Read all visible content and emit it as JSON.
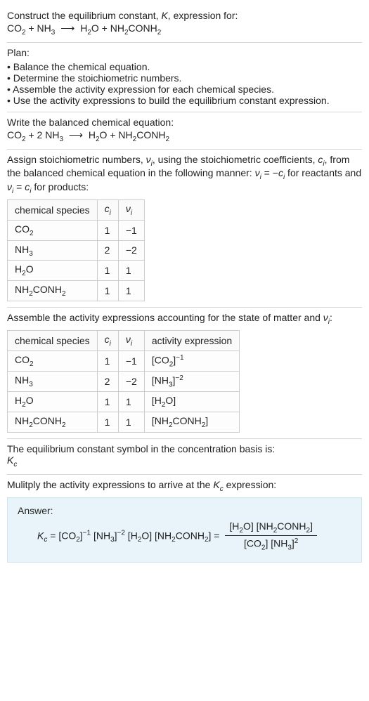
{
  "intro": {
    "line1": "Construct the equilibrium constant, ",
    "kital": "K",
    "line1b": ", expression for:"
  },
  "eq_unbalanced": {
    "co2": "CO",
    "co2_sub": "2",
    "plus1": " + ",
    "nh3": "NH",
    "nh3_sub": "3",
    "arrow": "⟶",
    "h2o": "H",
    "h2o_sub": "2",
    "h2o_o": "O",
    "plus2": " + ",
    "nh2conh2": "NH",
    "nh2_sub": "2",
    "conh": "CONH",
    "conh_sub": "2"
  },
  "plan": {
    "title": "Plan:",
    "items": [
      "Balance the chemical equation.",
      "Determine the stoichiometric numbers.",
      "Assemble the activity expression for each chemical species.",
      "Use the activity expressions to build the equilibrium constant expression."
    ]
  },
  "balanced": {
    "title": "Write the balanced chemical equation:",
    "co2": "CO",
    "co2_sub": "2",
    "plus1": " + 2 ",
    "nh3": "NH",
    "nh3_sub": "3",
    "arrow": "⟶",
    "h2o": "H",
    "h2o_sub": "2",
    "h2o_o": "O",
    "plus2": " + ",
    "nh2conh2": "NH",
    "nh2_sub": "2",
    "conh": "CONH",
    "conh_sub": "2"
  },
  "assign": {
    "part1": "Assign stoichiometric numbers, ",
    "nu": "ν",
    "i": "i",
    "part2": ", using the stoichiometric coefficients, ",
    "c": "c",
    "part3": ", from the balanced chemical equation in the following manner: ",
    "eq1a": "ν",
    "eq1b": " = −",
    "eq1c": "c",
    "part4": " for reactants and ",
    "eq2a": "ν",
    "eq2b": " = ",
    "eq2c": "c",
    "part5": " for products:"
  },
  "table1": {
    "headers": {
      "h1": "chemical species",
      "h2": "c",
      "h2i": "i",
      "h3": "ν",
      "h3i": "i"
    },
    "rows": [
      {
        "sp": "CO",
        "spsub": "2",
        "c": "1",
        "nu": "−1"
      },
      {
        "sp": "NH",
        "spsub": "3",
        "c": "2",
        "nu": "−2"
      },
      {
        "sp": "H",
        "spsub": "2",
        "sp2": "O",
        "c": "1",
        "nu": "1"
      },
      {
        "sp": "NH",
        "spsub": "2",
        "sp2": "CONH",
        "sp2sub": "2",
        "c": "1",
        "nu": "1"
      }
    ]
  },
  "assemble": {
    "text1": "Assemble the activity expressions accounting for the state of matter and ",
    "nu": "ν",
    "i": "i",
    "text2": ":"
  },
  "table2": {
    "headers": {
      "h1": "chemical species",
      "h2": "c",
      "h2i": "i",
      "h3": "ν",
      "h3i": "i",
      "h4": "activity expression"
    },
    "rows": [
      {
        "sp": "CO",
        "spsub": "2",
        "c": "1",
        "nu": "−1",
        "act_base": "[CO",
        "act_sub": "2",
        "act_close": "]",
        "act_exp": "−1"
      },
      {
        "sp": "NH",
        "spsub": "3",
        "c": "2",
        "nu": "−2",
        "act_base": "[NH",
        "act_sub": "3",
        "act_close": "]",
        "act_exp": "−2"
      },
      {
        "sp": "H",
        "spsub": "2",
        "sp2": "O",
        "c": "1",
        "nu": "1",
        "act_base": "[H",
        "act_sub": "2",
        "act_close": "O]"
      },
      {
        "sp": "NH",
        "spsub": "2",
        "sp2": "CONH",
        "sp2sub": "2",
        "c": "1",
        "nu": "1",
        "act_base": "[NH",
        "act_sub": "2",
        "act_close": "CONH",
        "act_sub2": "2",
        "act_close2": "]"
      }
    ]
  },
  "kc_symbol": {
    "line1": "The equilibrium constant symbol in the concentration basis is:",
    "k": "K",
    "c": "c"
  },
  "multiply": {
    "text1": "Mulitply the activity expressions to arrive at the ",
    "k": "K",
    "c": "c",
    "text2": " expression:"
  },
  "answer": {
    "label": "Answer:",
    "kc_k": "K",
    "kc_c": "c",
    "equals": " = ",
    "t1": "[CO",
    "t1s": "2",
    "t1c": "]",
    "t1e": "−1",
    "t2": " [NH",
    "t2s": "3",
    "t2c": "]",
    "t2e": "−2",
    "t3": " [H",
    "t3s": "2",
    "t3c": "O]",
    "t4": " [NH",
    "t4s": "2",
    "t4c": "CONH",
    "t4s2": "2",
    "t4c2": "]",
    "equals2": " = ",
    "num1": "[H",
    "num1s": "2",
    "num1c": "O] [NH",
    "num1s2": "2",
    "num1c2": "CONH",
    "num1s3": "2",
    "num1c3": "]",
    "den1": "[CO",
    "den1s": "2",
    "den1c": "] [NH",
    "den1s2": "3",
    "den1c2": "]",
    "den1e": "2"
  }
}
